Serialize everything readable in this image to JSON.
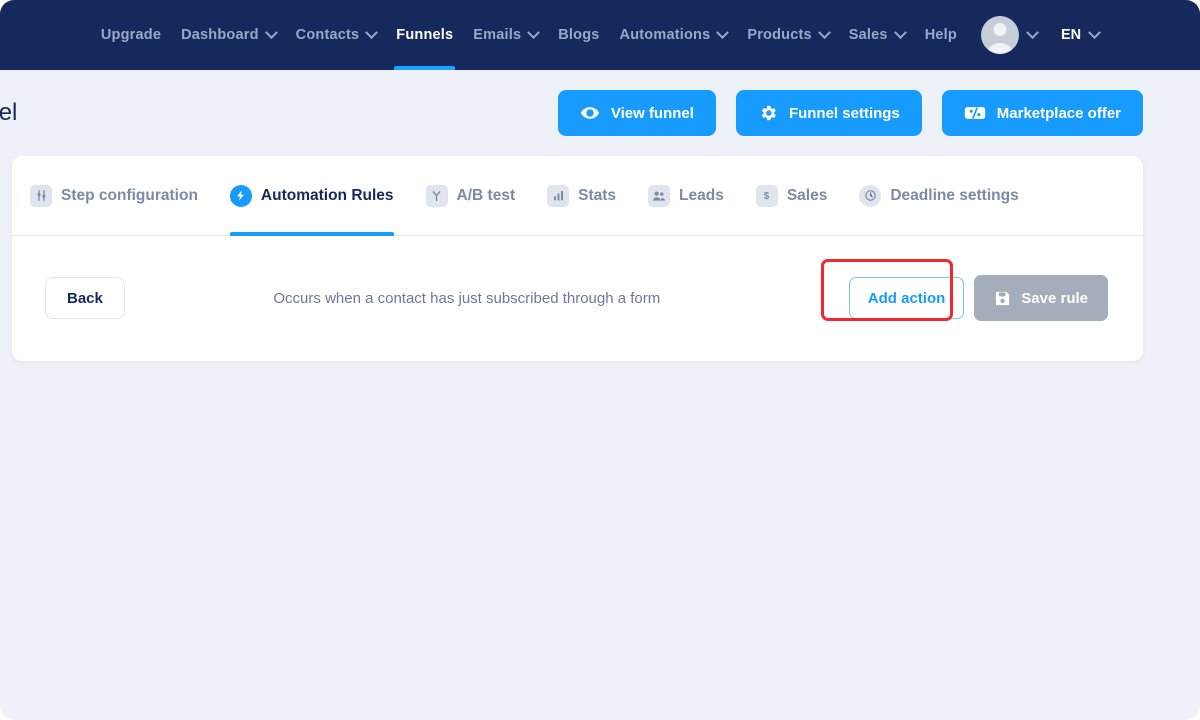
{
  "navbar": {
    "items": [
      {
        "label": "Upgrade",
        "caret": false,
        "active": false
      },
      {
        "label": "Dashboard",
        "caret": true,
        "active": false
      },
      {
        "label": "Contacts",
        "caret": true,
        "active": false
      },
      {
        "label": "Funnels",
        "caret": false,
        "active": true
      },
      {
        "label": "Emails",
        "caret": true,
        "active": false
      },
      {
        "label": "Blogs",
        "caret": false,
        "active": false
      },
      {
        "label": "Automations",
        "caret": true,
        "active": false
      },
      {
        "label": "Products",
        "caret": true,
        "active": false
      },
      {
        "label": "Sales",
        "caret": true,
        "active": false
      },
      {
        "label": "Help",
        "caret": false,
        "active": false
      }
    ],
    "avatar_icon": "user-avatar-icon",
    "language": "EN",
    "background_color": "#16295c",
    "active_underline_color": "#17a2ff"
  },
  "header": {
    "title": "nnel",
    "buttons": [
      {
        "label": "View funnel",
        "icon": "eye-icon"
      },
      {
        "label": "Funnel settings",
        "icon": "gear-icon"
      },
      {
        "label": "Marketplace offer",
        "icon": "ticket-percent-icon"
      }
    ],
    "accent_color": "#189bff"
  },
  "tabs": [
    {
      "label": "Step configuration",
      "icon": "sliders-icon",
      "active": false
    },
    {
      "label": "Automation Rules",
      "icon": "lightning-bolt-icon",
      "active": true
    },
    {
      "label": "A/B test",
      "icon": "branch-split-icon",
      "active": false
    },
    {
      "label": "Stats",
      "icon": "bar-chart-icon",
      "active": false
    },
    {
      "label": "Leads",
      "icon": "people-icon",
      "active": false
    },
    {
      "label": "Sales",
      "icon": "dollar-icon",
      "active": false
    },
    {
      "label": "Deadline settings",
      "icon": "clock-icon",
      "active": false
    }
  ],
  "rule": {
    "back_label": "Back",
    "description": "Occurs when a contact has just subscribed through a form",
    "add_action_label": "Add action",
    "save_rule_label": "Save rule",
    "save_icon": "floppy-disk-icon",
    "highlight_color": "#f5262c"
  }
}
